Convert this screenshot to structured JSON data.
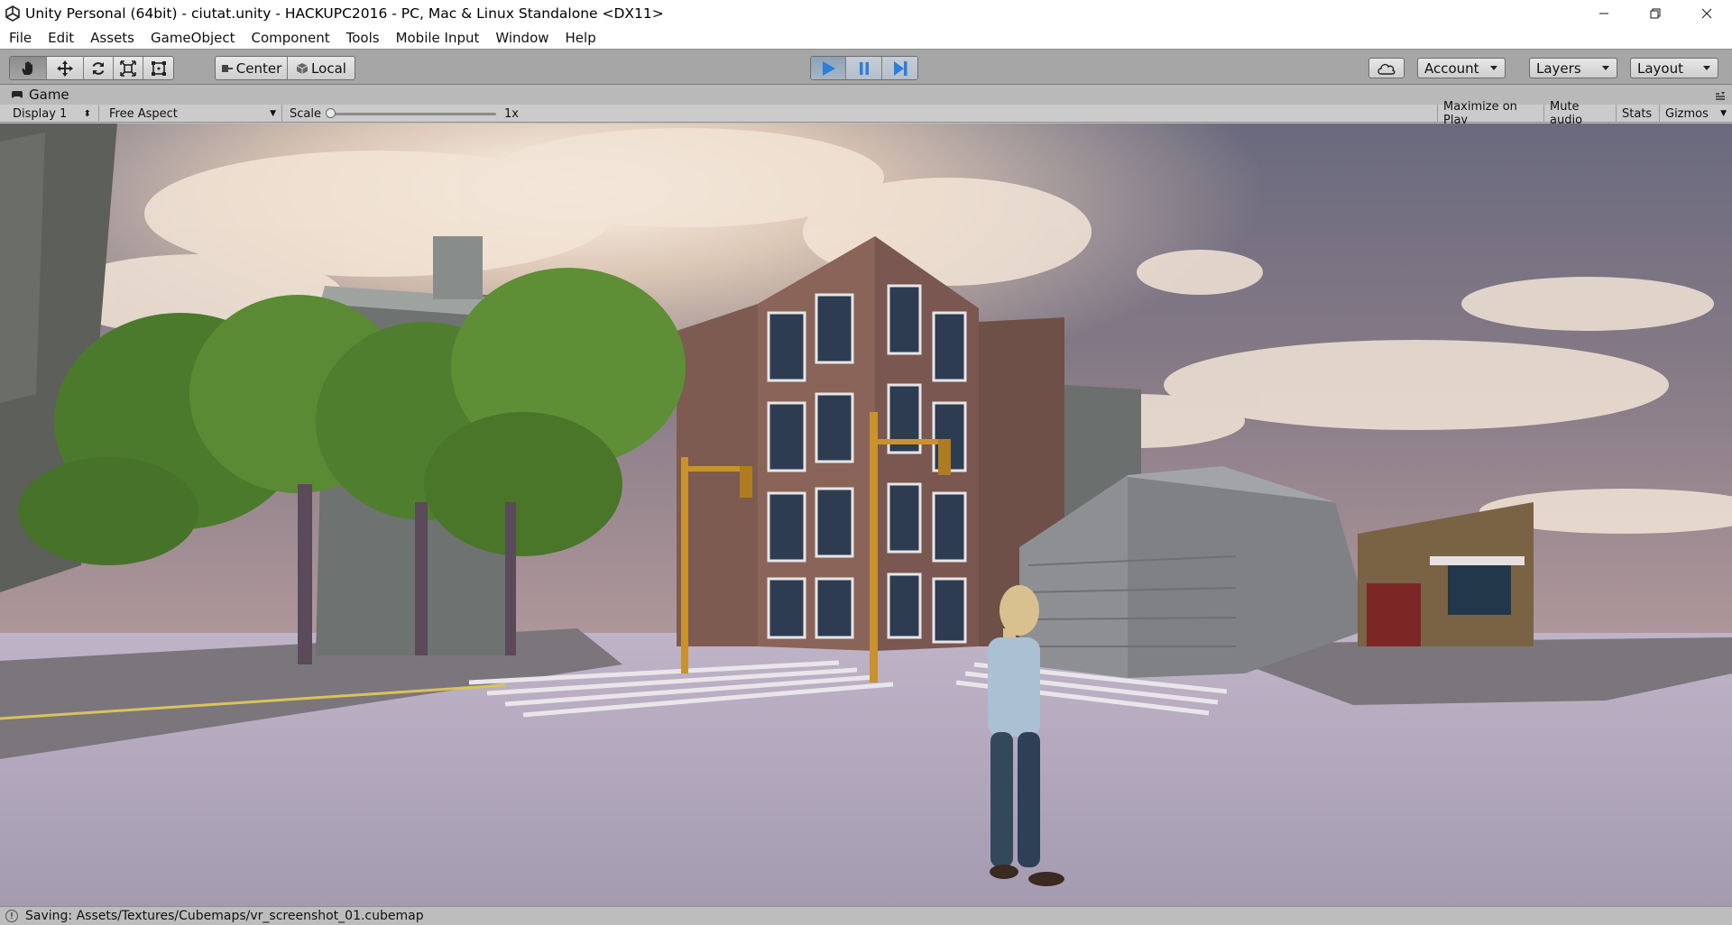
{
  "window": {
    "title": "Unity Personal (64bit) - ciutat.unity - HACKUPC2016 - PC, Mac & Linux Standalone <DX11>"
  },
  "menu": [
    "File",
    "Edit",
    "Assets",
    "GameObject",
    "Component",
    "Tools",
    "Mobile Input",
    "Window",
    "Help"
  ],
  "toolbar": {
    "pivot": "Center",
    "space": "Local",
    "account": "Account",
    "layers": "Layers",
    "layout": "Layout"
  },
  "game_view": {
    "tab_label": "Game",
    "display": "Display 1",
    "aspect": "Free Aspect",
    "scale_label": "Scale",
    "scale_value": "1x",
    "maximize_on_play": "Maximize on Play",
    "mute_audio": "Mute audio",
    "stats": "Stats",
    "gizmos": "Gizmos"
  },
  "status": {
    "message": "Saving: Assets/Textures/Cubemaps/vr_screenshot_01.cubemap"
  },
  "colors": {
    "play_active": "#2d7fd8",
    "toolbar_bg": "#a6a6a6",
    "sky": "#6b6577",
    "ground": "#b7aebf"
  }
}
